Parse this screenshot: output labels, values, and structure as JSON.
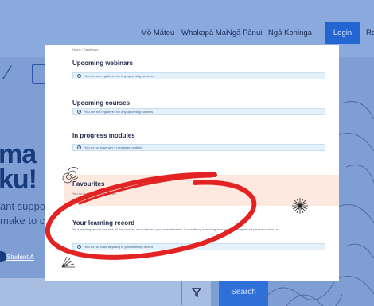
{
  "nav": {
    "items": [
      "Mō Mātou",
      "Whakapā Mai",
      "Ngā Pānui",
      "Ngā Kohinga"
    ],
    "login_label": "Login",
    "extra": "Re"
  },
  "hero": {
    "word1": "ma",
    "word2": "ku!",
    "line1": "ant suppo",
    "line2": "make to c",
    "student_link": "Student A"
  },
  "search": {
    "button_label": "Search"
  },
  "panel": {
    "breadcrumb": "Home / Dashboard",
    "sections": [
      {
        "title": "Upcoming webinars",
        "notice": "You are not registered for any upcoming webinars"
      },
      {
        "title": "Upcoming courses",
        "notice": "You are not registered for any upcoming courses"
      },
      {
        "title": "In progress modules",
        "notice": "You do not have any in progress modules"
      }
    ],
    "favourites": {
      "title": "Favourites",
      "text": "You do not have any favourites"
    },
    "learning_record": {
      "title": "Your learning record",
      "text": "Your learning record contains all the courses and webinars you have attended. If something is missing from your learning record please contact us.",
      "notice": "You do not have anything in your learning record"
    }
  },
  "colors": {
    "background": "#7f9fd4",
    "accent": "#2466d1",
    "annotation": "#e32323",
    "favourites_bg": "#fde9df",
    "notice_bg": "#e4f1fb"
  }
}
